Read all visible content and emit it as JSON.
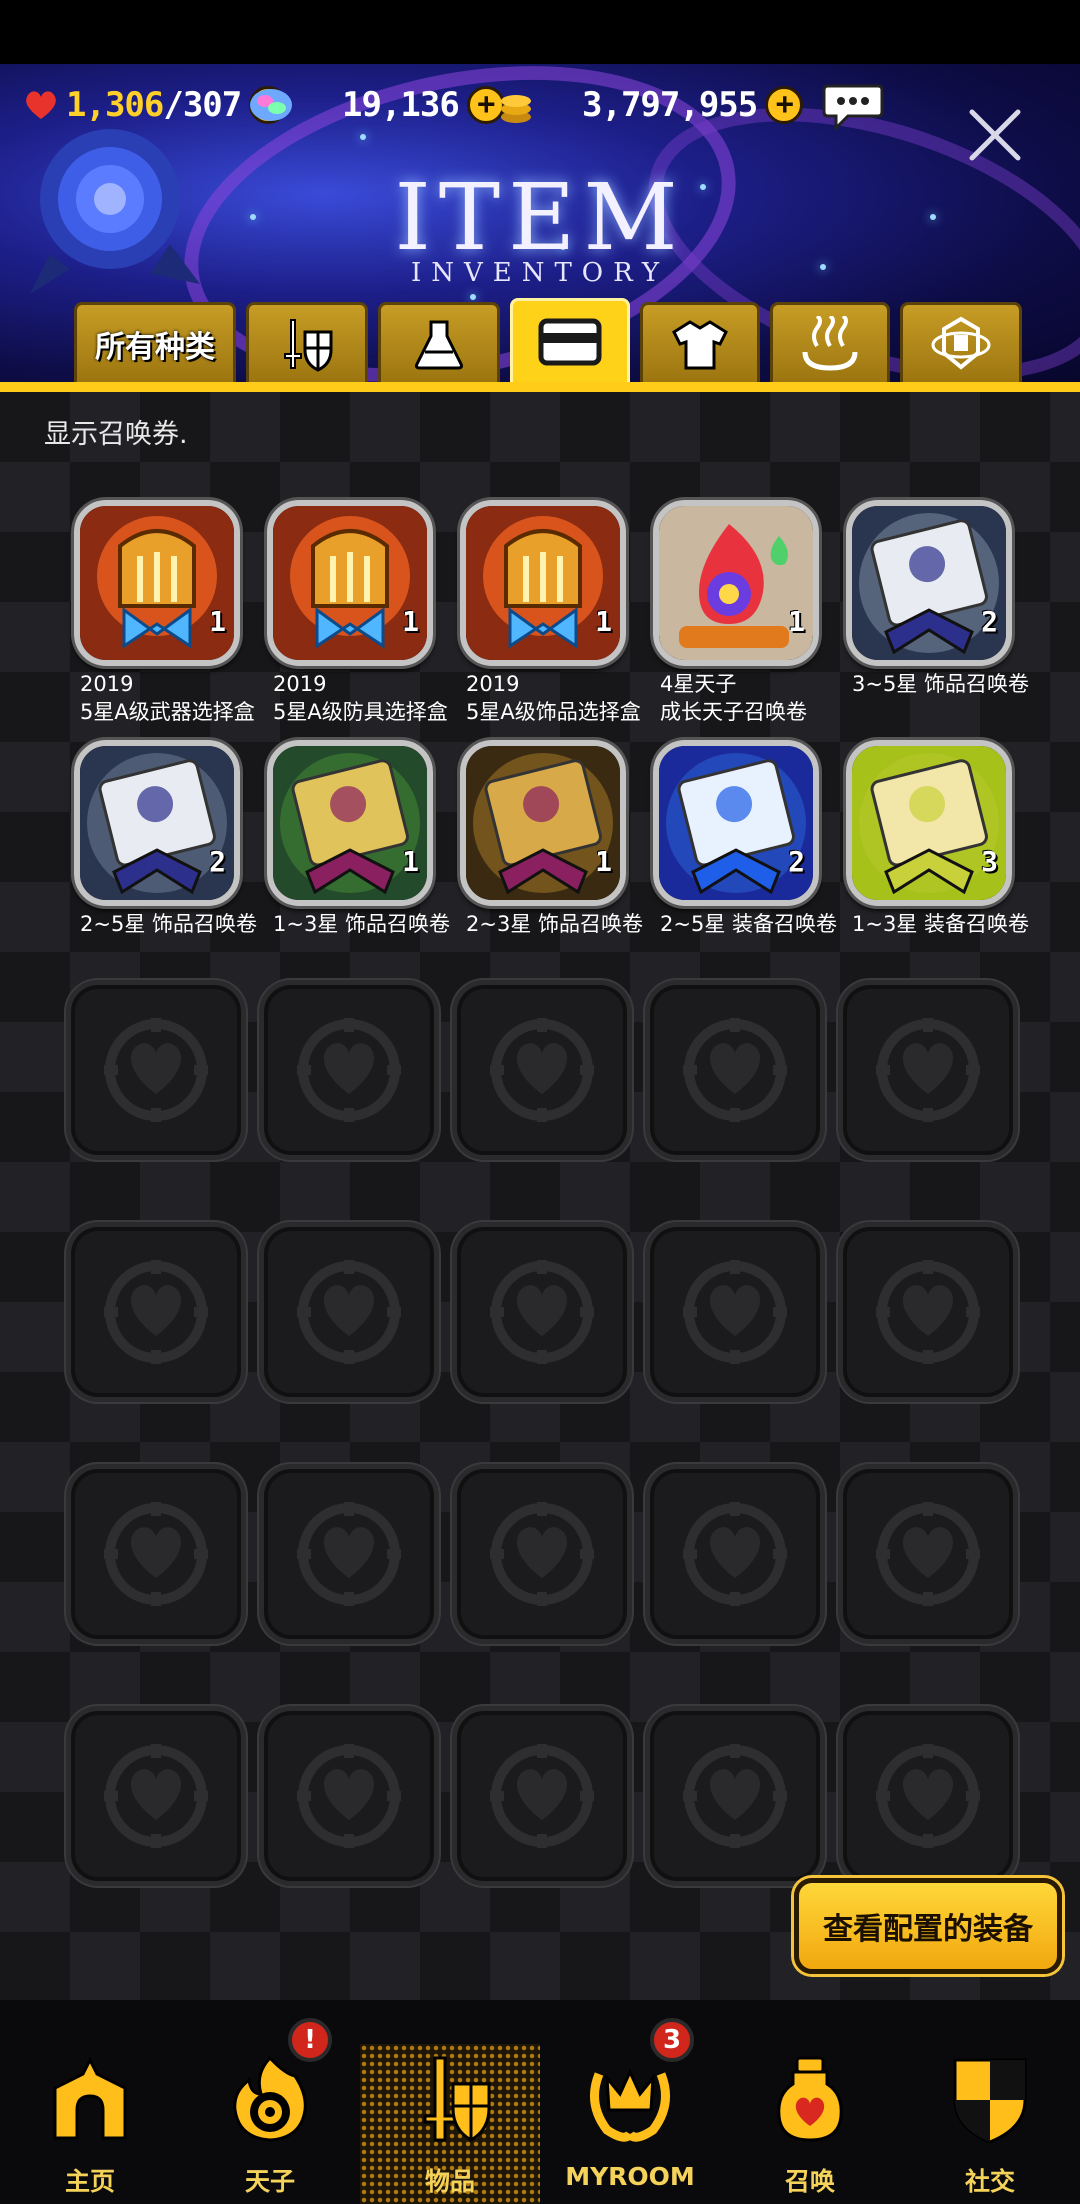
{
  "resources": {
    "stamina_current": "1,306",
    "stamina_max": "/307",
    "gems": "19,136",
    "gold": "3,797,955"
  },
  "header": {
    "title": "ITEM",
    "subtitle": "INVENTORY"
  },
  "tabs": [
    {
      "label": "所有种类",
      "icon": "all-types"
    },
    {
      "label": "",
      "icon": "sword-shield-icon"
    },
    {
      "label": "",
      "icon": "flask-icon"
    },
    {
      "label": "",
      "icon": "ticket-icon",
      "active": true
    },
    {
      "label": "",
      "icon": "shirt-icon"
    },
    {
      "label": "",
      "icon": "hot-spring-icon"
    },
    {
      "label": "",
      "icon": "emblem-icon"
    }
  ],
  "hint": "显示召唤券.",
  "items": [
    {
      "line1": "2019",
      "line2": "5星A级武器选择盒",
      "qty": "1",
      "art": "helmet-box",
      "color": "#e8a02a"
    },
    {
      "line1": "2019",
      "line2": "5星A级防具选择盒",
      "qty": "1",
      "art": "helmet-box",
      "color": "#e8a02a"
    },
    {
      "line1": "2019",
      "line2": "5星A级饰品选择盒",
      "qty": "1",
      "art": "helmet-box",
      "color": "#e8a02a"
    },
    {
      "line1": "4星天子",
      "line2": "成长天子召唤卷",
      "qty": "1",
      "art": "flame-scroll",
      "color": "#d94b7a"
    },
    {
      "line1": "3~5星 饰品召唤卷",
      "line2": "",
      "qty": "2",
      "art": "ticket-silver",
      "color": "#8a9bb0"
    },
    {
      "line1": "2~5星 饰品召唤卷",
      "line2": "",
      "qty": "2",
      "art": "ticket-silver",
      "color": "#7b8aa0"
    },
    {
      "line1": "1~3星 饰品召唤卷",
      "line2": "",
      "qty": "1",
      "art": "ticket-green",
      "color": "#4c9a3a"
    },
    {
      "line1": "2~3星 饰品召唤卷",
      "line2": "",
      "qty": "1",
      "art": "ticket-gold",
      "color": "#b8872a"
    },
    {
      "line1": "2~5星 装备召唤卷",
      "line2": "",
      "qty": "2",
      "art": "ticket-blue",
      "color": "#2f6de0"
    },
    {
      "line1": "1~3星 装备召唤卷",
      "line2": "",
      "qty": "3",
      "art": "ticket-yellow",
      "color": "#b7c930"
    }
  ],
  "view_button": "查看配置的装备",
  "nav": [
    {
      "label": "主页",
      "icon": "home-icon"
    },
    {
      "label": "天子",
      "icon": "flame-eye-icon",
      "badge": "!"
    },
    {
      "label": "物品",
      "icon": "sword-shield-icon",
      "active": true
    },
    {
      "label": "MYROOM",
      "icon": "crown-wreath-icon",
      "badge": "3"
    },
    {
      "label": "召唤",
      "icon": "summon-potion-icon"
    },
    {
      "label": "社交",
      "icon": "shield-crest-icon"
    }
  ]
}
